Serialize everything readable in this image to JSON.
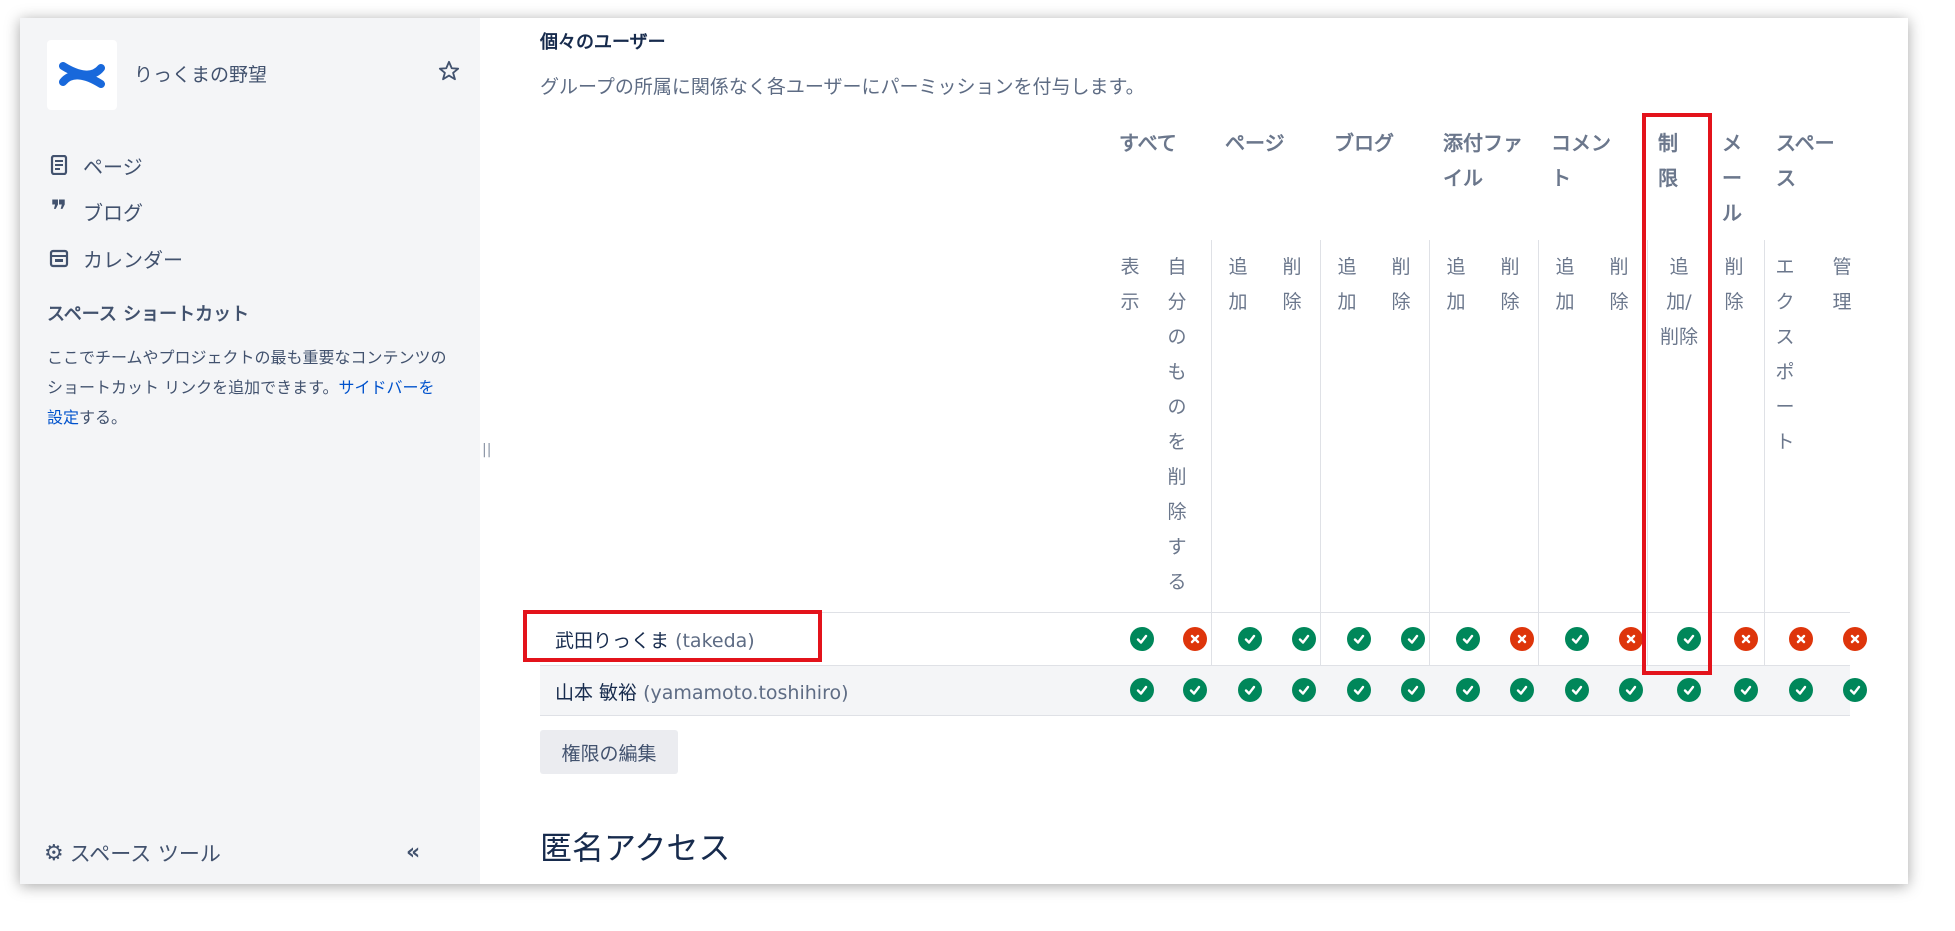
{
  "sidebar": {
    "space_name": "りっくまの野望",
    "nav": [
      {
        "label": "ページ",
        "icon": "page-icon"
      },
      {
        "label": "ブログ",
        "icon": "quote-icon"
      },
      {
        "label": "カレンダー",
        "icon": "calendar-icon"
      }
    ],
    "shortcuts_heading": "スペース ショートカット",
    "shortcuts_text": "ここでチームやプロジェクトの最も重要なコンテンツのショートカット リンクを追加できます。",
    "shortcuts_link": "サイドバーを設定",
    "shortcuts_suffix": "する。",
    "space_tools": "スペース ツール",
    "collapse_label": "«"
  },
  "main": {
    "heading": "個々のユーザー",
    "description": "グループの所属に関係なく各ユーザーにパーミッションを付与します。",
    "groups": [
      {
        "label": "すべて"
      },
      {
        "label": "ページ"
      },
      {
        "label": "ブログ"
      },
      {
        "label": "添付ファイル"
      },
      {
        "label": "コメント"
      },
      {
        "label": "制限"
      },
      {
        "label": "メール"
      },
      {
        "label": "スペース"
      }
    ],
    "columns": [
      "表示",
      "自分のものを削除する",
      "追加",
      "削除",
      "追加",
      "削除",
      "追加",
      "削除",
      "追加",
      "削除",
      "追加/削除",
      "削除",
      "エクスポート",
      "管理"
    ],
    "users": [
      {
        "name": "武田りっくま",
        "id": "(takeda)",
        "perms": [
          true,
          false,
          true,
          true,
          true,
          true,
          true,
          false,
          true,
          false,
          true,
          false,
          false,
          false
        ]
      },
      {
        "name": "山本 敏裕",
        "id": "(yamamoto.toshihiro)",
        "perms": [
          true,
          true,
          true,
          true,
          true,
          true,
          true,
          true,
          true,
          true,
          true,
          true,
          true,
          true
        ]
      }
    ],
    "edit_button": "権限の編集",
    "anonymous_heading": "匿名アクセス"
  }
}
